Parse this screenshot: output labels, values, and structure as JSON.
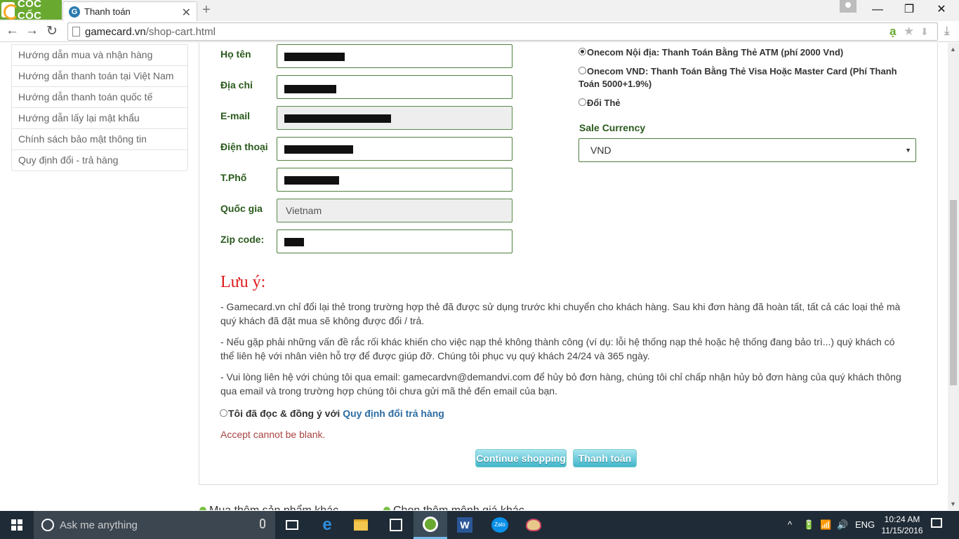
{
  "browser": {
    "brand": "CỐC CỐC",
    "tab": {
      "favicon": "G",
      "title": "Thanh toán",
      "close": "✕"
    },
    "new_tab": "+",
    "window_controls": {
      "minimize": "—",
      "maximize": "❐",
      "close": "✕"
    },
    "nav": {
      "back": "←",
      "forward": "→",
      "reload": "↻"
    },
    "url_domain": "gamecard.vn",
    "url_path": "/shop-cart.html",
    "omnibox_icons": {
      "translate": "ạ",
      "bookmark": "★",
      "download": "⬇"
    },
    "download_button": "⤓"
  },
  "sidebar": {
    "items": [
      "Hướng dẫn mua và nhận hàng",
      "Hướng dẫn thanh toán tại Việt Nam",
      "Hướng dẫn thanh toán quốc tế",
      "Hướng dẫn lấy lại mật khẩu",
      "Chính sách bảo mật thông tin",
      "Quy định đổi - trả hàng"
    ]
  },
  "form": {
    "name_label": "Họ tên",
    "address_label": "Địa chỉ",
    "email_label": "E-mail",
    "phone_label": "Điện thoại",
    "city_label": "T.Phố",
    "country_label": "Quốc gia",
    "country_value": "Vietnam",
    "zip_label": "Zip code:"
  },
  "payment": {
    "options": [
      {
        "label": "Onecom Nội địa: Thanh Toán Bằng Thẻ ATM (phí 2000 Vnd)",
        "selected": true
      },
      {
        "label": "Onecom VND: Thanh Toán Bằng Thẻ Visa Hoặc Master Card (Phí Thanh",
        "label2": "Toán 5000+1.9%)",
        "selected": false
      },
      {
        "label": "Đổi Thẻ",
        "selected": false
      }
    ],
    "currency_label": "Sale Currency",
    "currency_value": "VND",
    "currency_arrow": "▼"
  },
  "note": {
    "title": "Lưu ý:",
    "p1_line1": "- Gamecard.vn chỉ đổi lại thẻ trong trường hợp thẻ đã được sử dụng trước khi chuyển cho khách hàng. Sau khi đơn hàng đã hoàn tất, tất cả các loại thẻ mà",
    "p1_line2": "quý khách đã đặt mua sẽ không được đổi / trả.",
    "p2_line1": "- Nếu gặp phải những vấn đề rắc rối khác khiến cho việc nạp thẻ không thành công (ví dụ: lỗi hệ thống nạp thẻ hoặc hệ thống đang bảo trì...) quý khách có",
    "p2_line2": "thể liên hệ với nhân viên hỗ trợ để được giúp đỡ. Chúng tôi phục vụ quý khách 24/24 và 365 ngày.",
    "p3_line1": "- Vui lòng liên hệ với chúng tôi qua email: gamecardvn@demandvi.com để hủy bỏ đơn hàng, chúng tôi chỉ chấp nhận hủy bỏ đơn hàng của quý khách thông",
    "p3_line2": "qua email và trong trường hợp chúng tôi chưa gửi mã thẻ đến email của bạn."
  },
  "agree": {
    "text": "Tôi đã đọc & đồng ý với ",
    "link": "Quy định đổi trả hàng",
    "error": "Accept cannot be blank."
  },
  "buttons": {
    "continue": "Continue shopping",
    "pay": "Thanh toán"
  },
  "more_links": [
    "Mua thêm sản phẩm khác",
    "Chọn thêm mệnh giá khác"
  ],
  "taskbar": {
    "search_placeholder": "Ask me anything",
    "language": "ENG",
    "time": "10:24 AM",
    "date": "11/15/2016",
    "tray_icons": [
      "^",
      "🔋",
      "📶",
      "🔊"
    ]
  },
  "colors": {
    "label_green": "#2a5a1c",
    "input_border": "#4f7f3f",
    "note_red": "#e01b1b",
    "link_blue": "#2d6ca2",
    "error_red": "#a94442",
    "button_teal": "#41b5c9",
    "brand_green": "#69a930"
  }
}
